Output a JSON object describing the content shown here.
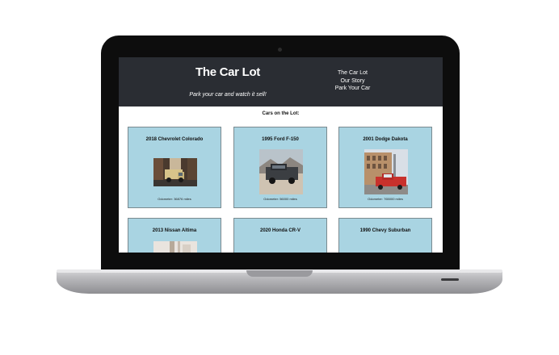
{
  "site": {
    "title": "The Car Lot",
    "tagline": "Park your car and watch it sell!",
    "nav": [
      "The Car Lot",
      "Our Story",
      "Park Your Car"
    ]
  },
  "lot": {
    "heading": "Cars on the Lot:",
    "cars": [
      {
        "name": "2018 Chevrolet Colorado",
        "odometer": "Odometer: 36876 miles",
        "image": "truck-street-photo"
      },
      {
        "name": "1995 Ford F-150",
        "odometer": "Odometer: 56000 miles",
        "image": "pickup-desert-photo"
      },
      {
        "name": "2001 Dodge Dakota",
        "odometer": "Odometer: 765000 miles",
        "image": "red-truck-building-photo"
      },
      {
        "name": "2013 Nissan Altima",
        "odometer": "",
        "image": "car-building-photo"
      },
      {
        "name": "2020 Honda CR-V",
        "odometer": "",
        "image": ""
      },
      {
        "name": "1990 Chevy Suburban",
        "odometer": "",
        "image": ""
      }
    ]
  }
}
